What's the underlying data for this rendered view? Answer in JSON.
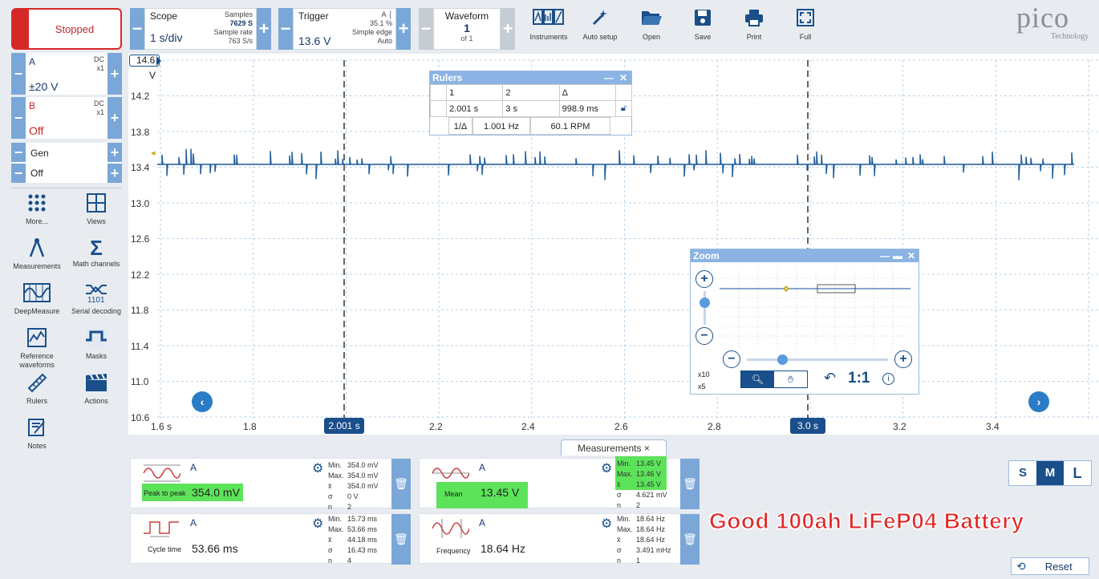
{
  "toolbar": {
    "stop_label": "Stopped",
    "scope": {
      "title": "Scope",
      "value": "1 s/div",
      "samples_label": "Samples",
      "samples": "7629 S",
      "rate_label": "Sample rate",
      "rate": "763 S/s"
    },
    "trigger": {
      "title": "Trigger",
      "value": "13.6 V",
      "channel": "A",
      "percent": "35.1 %",
      "mode1": "Simple edge",
      "mode2": "Auto"
    },
    "waveform": {
      "title": "Waveform",
      "value": "1",
      "of": "of 1"
    },
    "buttons": [
      "Instruments",
      "Auto setup",
      "Open",
      "Save",
      "Print",
      "Full"
    ],
    "logo": "pico",
    "logo_sub": "Technology"
  },
  "channels": {
    "a": {
      "name": "A",
      "coupling": "DC",
      "probe": "x1",
      "range": "±20 V"
    },
    "b": {
      "name": "B",
      "coupling": "DC",
      "probe": "x1",
      "range": "Off"
    },
    "gen": {
      "name": "Gen",
      "state": "Off"
    }
  },
  "tools": [
    "More...",
    "Views",
    "Measurements",
    "Math channels",
    "DeepMeasure",
    "Serial decoding",
    "Reference waveforms",
    "Masks",
    "Rulers",
    "Actions",
    "Notes"
  ],
  "plot": {
    "ytop": "14.6",
    "yunit": "V",
    "ylabels": [
      "14.2",
      "13.8",
      "13.4",
      "13.0",
      "12.6",
      "12.2",
      "11.8",
      "11.4",
      "11.0",
      "10.6"
    ],
    "xlabels": [
      "1.6 s",
      "1.8",
      "2.2",
      "2.4",
      "2.6",
      "2.8",
      "3.2",
      "3.4"
    ],
    "ruler1": "2.001 s",
    "ruler2": "3.0 s",
    "line_color": "#1a5a9a"
  },
  "rulers": {
    "title": "Rulers",
    "h1": "1",
    "h2": "2",
    "h3": "Δ",
    "v1": "2.001 s",
    "v2": "3 s",
    "v3": "998.9 ms",
    "inv_label": "1/Δ",
    "freq": "1.001 Hz",
    "rpm": "60.1 RPM"
  },
  "zoom": {
    "title": "Zoom",
    "x10": "x10",
    "x5": "x5",
    "ratio": "1:1"
  },
  "measurements_tab": "Measurements",
  "measurements": [
    {
      "channel": "A",
      "name": "Peak to peak",
      "value": "354.0 mV",
      "labels": [
        "Min.",
        "Max.",
        "x̄",
        "σ",
        "n"
      ],
      "stats": [
        "354.0 mV",
        "354.0 mV",
        "354.0 mV",
        "0 V",
        "2"
      ]
    },
    {
      "channel": "A",
      "name": "Mean",
      "value": "13.45 V",
      "labels": [
        "Min.",
        "Max.",
        "x̄",
        "σ",
        "n"
      ],
      "stats": [
        "13.45 V",
        "13.46 V",
        "13.45 V",
        "4.621 mV",
        "2"
      ]
    },
    {
      "channel": "A",
      "name": "Cycle time",
      "value": "53.66 ms",
      "labels": [
        "Min.",
        "Max.",
        "x̄",
        "σ",
        "n"
      ],
      "stats": [
        "15.73 ms",
        "53.66 ms",
        "44.18 ms",
        "16.43 ms",
        "4"
      ]
    },
    {
      "channel": "A",
      "name": "Frequency",
      "value": "18.64 Hz",
      "labels": [
        "Min.",
        "Max.",
        "x̄",
        "σ",
        "n"
      ],
      "stats": [
        "18.64 Hz",
        "18.64 Hz",
        "18.64 Hz",
        "3.491 mHz",
        "1"
      ]
    }
  ],
  "size_buttons": [
    "S",
    "M",
    "L"
  ],
  "overlay_text": "Good 100ah LiFeP04 Battery",
  "reset_label": "Reset"
}
